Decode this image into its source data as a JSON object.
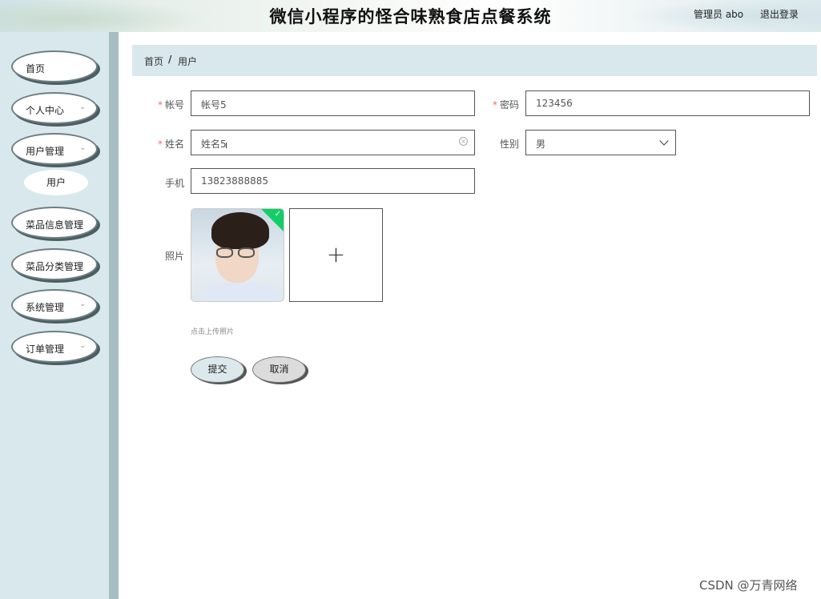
{
  "header": {
    "title": "微信小程序的怪合味熟食店点餐系统",
    "admin_label": "管理员 abo",
    "logout_label": "退出登录"
  },
  "sidebar": {
    "items": [
      {
        "label": "首页"
      },
      {
        "label": "个人中心"
      },
      {
        "label": "用户管理"
      },
      {
        "label": "菜品信息管理"
      },
      {
        "label": "菜品分类管理"
      },
      {
        "label": "系统管理"
      },
      {
        "label": "订单管理"
      }
    ],
    "sub_item": "用户"
  },
  "breadcrumb": {
    "home": "首页",
    "separator": "/",
    "current": "用户"
  },
  "form": {
    "account": {
      "label": "帐号",
      "value": "帐号5",
      "required": true
    },
    "password": {
      "label": "密码",
      "value": "123456",
      "required": true
    },
    "name": {
      "label": "姓名",
      "value": "姓名5",
      "required": true
    },
    "gender": {
      "label": "性别",
      "value": "男"
    },
    "phone": {
      "label": "手机",
      "value": "13823888885"
    },
    "photo": {
      "label": "照片",
      "hint": "点击上传照片"
    }
  },
  "buttons": {
    "submit": "提交",
    "cancel": "取消"
  },
  "watermark": "CSDN @万青网络",
  "colors": {
    "sidebar_bg": "#d9e8ec",
    "accent_bar": "#a6bfc3",
    "required_mark": "#f56c6c",
    "success_badge": "#13ce66"
  }
}
